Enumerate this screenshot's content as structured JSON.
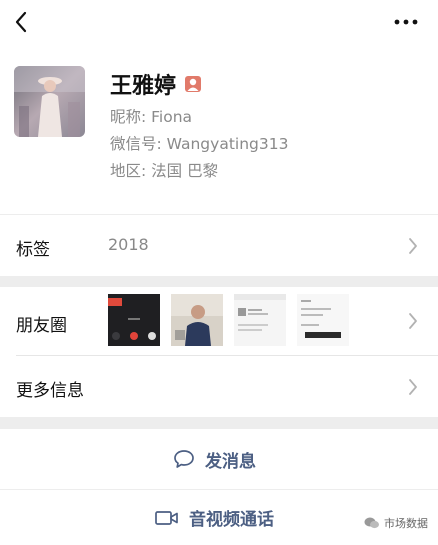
{
  "topbar": {
    "back_icon": "chevron-left-icon",
    "more_icon": "ellipsis-icon"
  },
  "profile": {
    "name": "王雅婷",
    "gender_icon": "female-person-icon",
    "nickname": "昵称: Fiona",
    "wechat_id": "微信号: Wangyating313",
    "region": "地区: 法国  巴黎"
  },
  "rows": {
    "tags": {
      "label": "标签",
      "value": "2018"
    },
    "moments": {
      "label": "朋友圈"
    },
    "more_info": {
      "label": "更多信息"
    }
  },
  "actions": {
    "message": {
      "label": "发消息",
      "icon": "chat-bubble-icon"
    },
    "call": {
      "label": "音视频通话",
      "icon": "video-camera-icon"
    }
  },
  "watermark": {
    "text": "市场数据"
  },
  "colors": {
    "action_text": "#4c5f83",
    "background": "#ededed",
    "secondary_text": "#8a8a8a",
    "gender_icon": "#e17a6a"
  }
}
